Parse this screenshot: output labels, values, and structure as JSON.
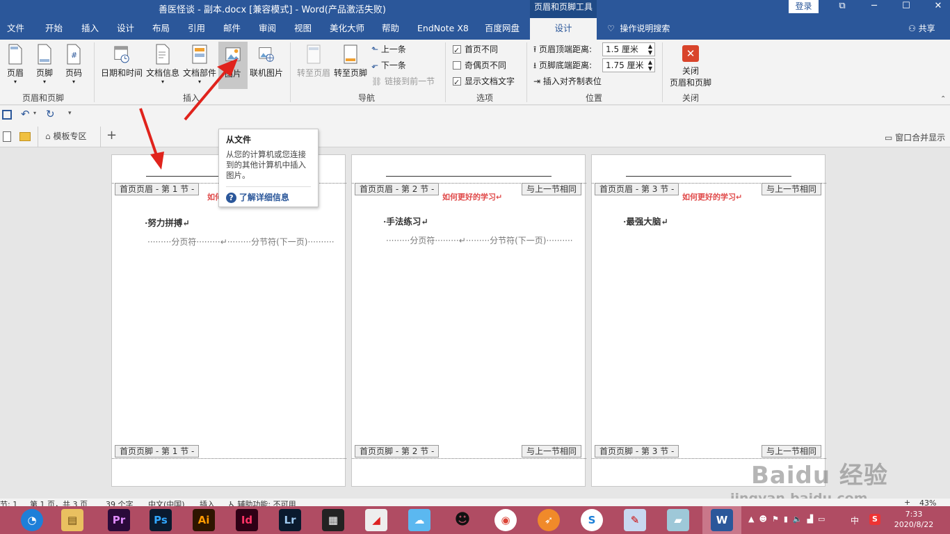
{
  "window": {
    "title": "善医怪谈 - 副本.docx [兼容模式]  -  Word(产品激活失败)",
    "context_tools": "页眉和页脚工具",
    "login": "登录",
    "controls": [
      "⧉",
      "─",
      "☐",
      "✕"
    ]
  },
  "tabs": {
    "items": [
      "文件",
      "开始",
      "插入",
      "设计",
      "布局",
      "引用",
      "邮件",
      "审阅",
      "视图",
      "美化大师",
      "帮助",
      "EndNote X8",
      "百度网盘"
    ],
    "active": "设计",
    "tell_me": "操作说明搜索",
    "share": "共享"
  },
  "ribbon": {
    "group_hf": {
      "label": "页眉和页脚",
      "header": "页眉",
      "footer": "页脚",
      "page_number": "页码"
    },
    "group_insert": {
      "label": "插入",
      "datetime": "日期和时间",
      "docinfo": "文档信息",
      "quickparts": "文档部件",
      "picture": "图片",
      "online_picture": "联机图片"
    },
    "group_nav": {
      "label": "导航",
      "goto_header": "转至页眉",
      "goto_footer": "转至页脚",
      "prev": "上一条",
      "next": "下一条",
      "link_prev": "链接到前一节"
    },
    "group_options": {
      "label": "选项",
      "first_page_diff": "首页不同",
      "odd_even_diff": "奇偶页不同",
      "show_doc_text": "显示文档文字"
    },
    "group_position": {
      "label": "位置",
      "header_top_label": "页眉顶端距离:",
      "header_top_value": "1.5 厘米",
      "footer_bottom_label": "页脚底端距离:",
      "footer_bottom_value": "1.75 厘米",
      "insert_align_tab": "插入对齐制表位"
    },
    "group_close": {
      "label": "关闭",
      "close_line1": "关闭",
      "close_line2": "页眉和页脚"
    }
  },
  "doc_tabs": {
    "template_zone": "模板专区",
    "merge_window": "窗口合并显示"
  },
  "tooltip": {
    "title": "从文件",
    "body": "从您的计算机或您连接到的其他计算机中插入图片。",
    "link": "了解详细信息"
  },
  "pages": [
    {
      "header_tag": "首页页眉 - 第 1 节 -",
      "footer_tag": "首页页脚 - 第 1 节 -",
      "same_as_prev": "",
      "footer_same": "",
      "red": "如何",
      "body": "·努力拼搏↵",
      "page_break": "分页符",
      "section_break": "分节符(下一页)"
    },
    {
      "header_tag": "首页页眉 - 第 2 节 -",
      "footer_tag": "首页页脚 - 第 2 节 -",
      "same_as_prev": "与上一节相同",
      "footer_same": "与上一节相同",
      "red": "如何更好的学习↵",
      "body": "·手法练习↵",
      "page_break": "分页符",
      "section_break": "分节符(下一页)"
    },
    {
      "header_tag": "首页页眉 - 第 3 节 -",
      "footer_tag": "首页页脚 - 第 3 节 -",
      "same_as_prev": "与上一节相同",
      "footer_same": "与上一节相同",
      "red": "如何更好的学习↵",
      "body": "·最强大脑↵",
      "page_break": "",
      "section_break": ""
    }
  ],
  "status": {
    "section": "节: 1",
    "page": "第 1 页，共 3 页",
    "words": "39 个字",
    "lang": "中文(中国)",
    "mode": "插入",
    "accessibility": "辅助功能: 不可用",
    "zoom": "43%"
  },
  "taskbar": {
    "apps": [
      "Pr",
      "Ps",
      "Ai",
      "Id",
      "Lr"
    ],
    "ime": "中",
    "time": "7:33",
    "date": "2020/8/22"
  },
  "watermark": {
    "line1": "Baidu 经验",
    "line2": "jingyan.baidu.com"
  }
}
